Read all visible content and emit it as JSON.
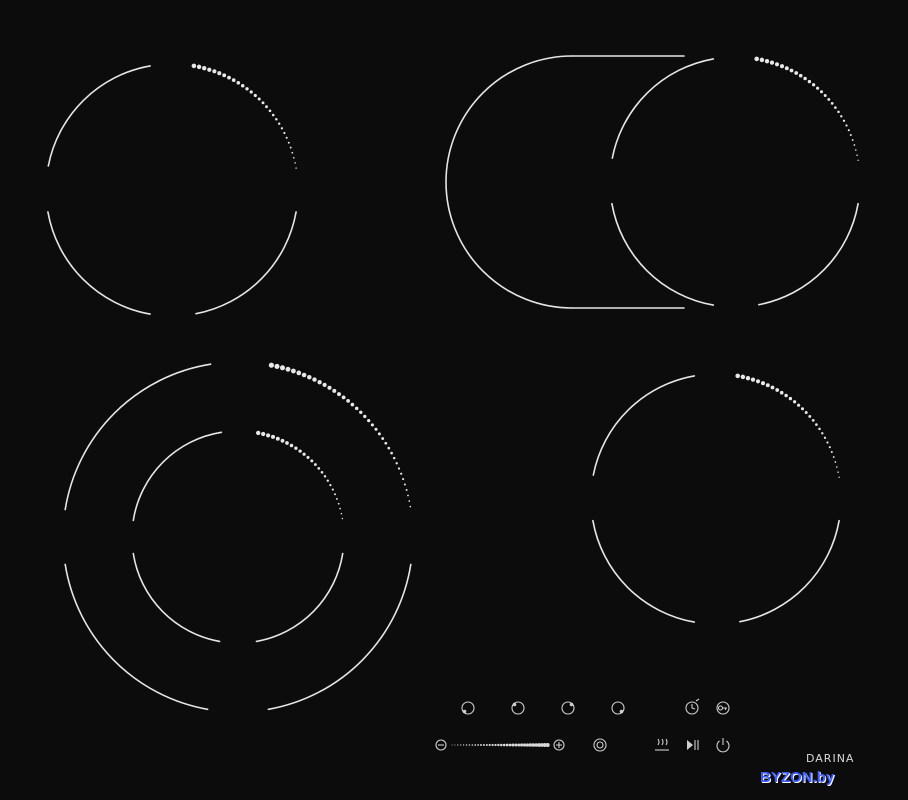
{
  "brand": {
    "name": "DARINA"
  },
  "watermark": {
    "text": "BYZON.by"
  },
  "colors": {
    "background": "#0c0c0c",
    "lines": "#e6e6e6",
    "watermark": "#3b5cff"
  },
  "cooking_zones": [
    {
      "id": "front-left-dual",
      "type": "dual-ring",
      "power_indicator": "dotted-arc"
    },
    {
      "id": "rear-left-single",
      "type": "single-ring",
      "power_indicator": "dotted-arc"
    },
    {
      "id": "rear-right-oval",
      "type": "oval-extension",
      "power_indicator": "dotted-arc"
    },
    {
      "id": "front-right-single",
      "type": "single-ring",
      "power_indicator": "dotted-arc"
    }
  ],
  "controls": {
    "zone_selectors": [
      "zone-select-front-left-icon",
      "zone-select-rear-left-icon",
      "zone-select-rear-right-icon",
      "zone-select-front-right-icon"
    ],
    "timer": "timer-icon",
    "lock": "key-lock-icon",
    "minus": "minus-icon",
    "plus": "plus-icon",
    "dual_zone": "dual-zone-icon",
    "keep_warm": "keep-warm-icon",
    "pause": "play-pause-icon",
    "power": "power-icon",
    "slider": "power-slider"
  }
}
